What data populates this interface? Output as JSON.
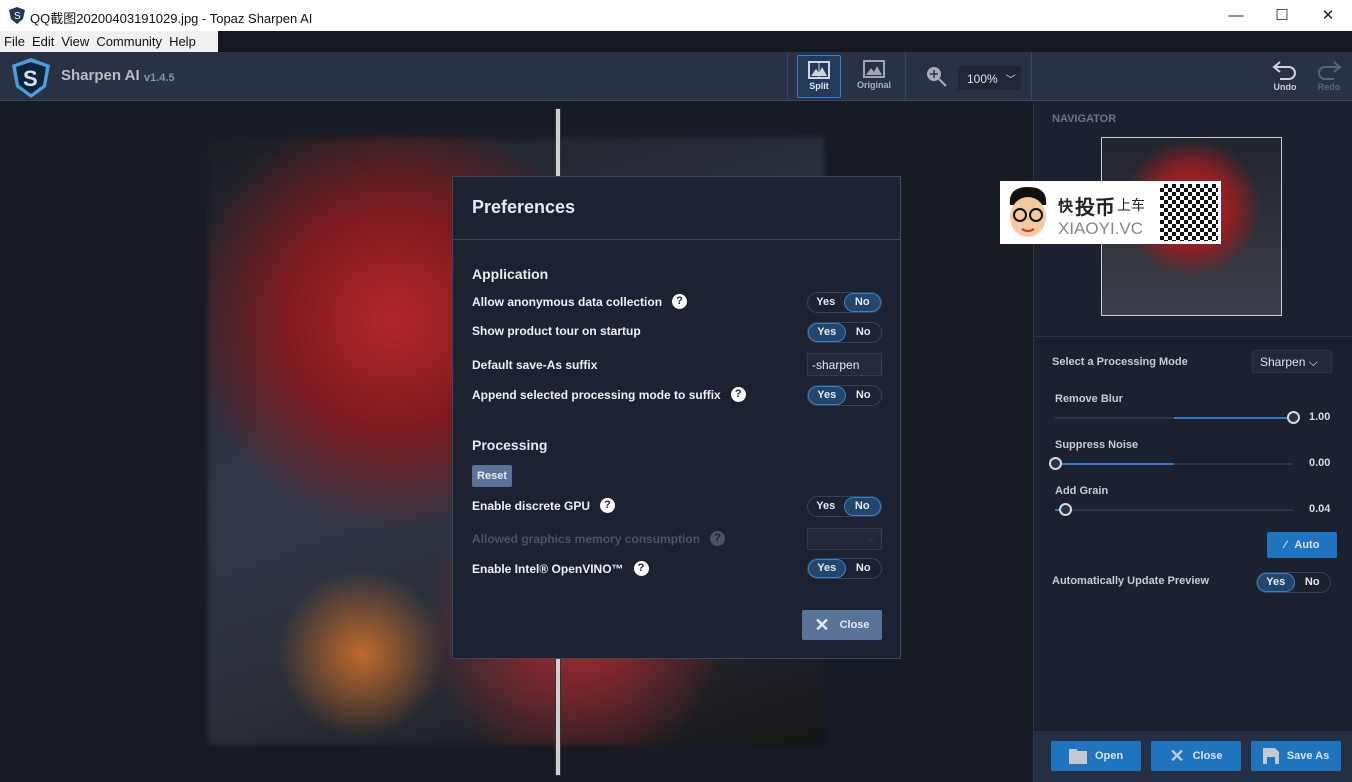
{
  "window": {
    "title": "QQ截图20200403191029.jpg - Topaz Sharpen AI",
    "minimize": "—",
    "maximize": "☐",
    "close": "✕"
  },
  "menu": [
    "File",
    "Edit",
    "View",
    "Community",
    "Help"
  ],
  "app": {
    "name": "Sharpen AI",
    "version": "v1.4.5",
    "logo_letter": "S"
  },
  "toolbar": {
    "split": "Split",
    "original": "Original",
    "zoom": "100%",
    "undo": "Undo",
    "redo": "Redo"
  },
  "navigator": {
    "title": "NAVIGATOR",
    "watermark": {
      "cn1": "快",
      "cn2": "投币",
      "cn3": "上车",
      "site": "XIAOYI.VC"
    }
  },
  "panel": {
    "mode_label": "Select a Processing Mode",
    "mode_value": "Sharpen",
    "sliders": [
      {
        "label": "Remove Blur",
        "value": "1.00",
        "fraction": 1.0,
        "center": 0.5
      },
      {
        "label": "Suppress Noise",
        "value": "0.00",
        "fraction": 0.0,
        "center": 0.5
      },
      {
        "label": "Add Grain",
        "value": "0.04",
        "fraction": 0.04,
        "center": 0.0
      }
    ],
    "auto": "Auto",
    "auto_update_label": "Automatically Update Preview",
    "yes": "Yes",
    "no": "No"
  },
  "bottom": {
    "open": "Open",
    "close": "Close",
    "save_as": "Save As"
  },
  "dialog": {
    "title": "Preferences",
    "application": "Application",
    "processing": "Processing",
    "reset": "Reset",
    "close": "Close",
    "rows": {
      "anon": "Allow anonymous data collection",
      "tour": "Show product tour on startup",
      "suffix": "Default save-As suffix",
      "suffix_value": "-sharpen",
      "append": "Append selected processing mode to suffix",
      "gpu": "Enable discrete GPU",
      "memory": "Allowed graphics memory consumption",
      "openvino": "Enable Intel® OpenVINO™"
    },
    "help": "?",
    "yes": "Yes",
    "no": "No"
  },
  "colors": {
    "accent": "#1f74bf",
    "toolbar": "#293244",
    "panel": "#1c2130"
  }
}
